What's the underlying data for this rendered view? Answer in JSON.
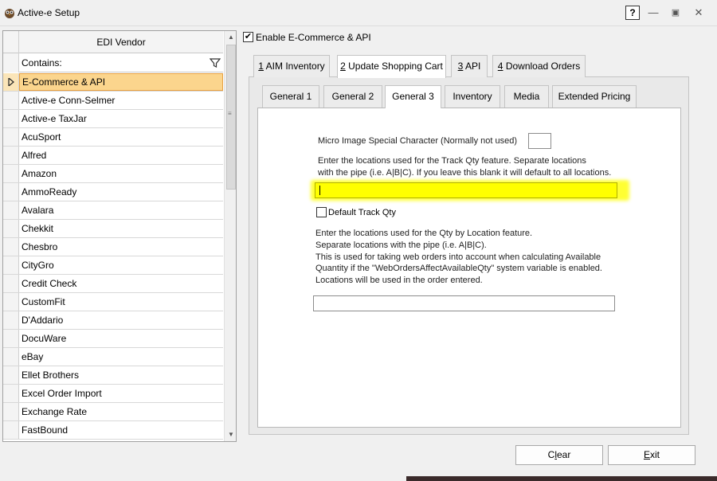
{
  "window": {
    "title": "Active-e Setup",
    "help_label": "?",
    "minimize_glyph": "—",
    "maximize_glyph": "▣",
    "close_glyph": "✕"
  },
  "vendor_grid": {
    "column_header": "EDI Vendor",
    "filter_label": "Contains:",
    "selected_index": 0,
    "rows": [
      "E-Commerce & API",
      "Active-e Conn-Selmer",
      "Active-e TaxJar",
      "AcuSport",
      "Alfred",
      "Amazon",
      "AmmoReady",
      "Avalara",
      "Chekkit",
      "Chesbro",
      "CityGro",
      "Credit Check",
      "CustomFit",
      "D'Addario",
      "DocuWare",
      "eBay",
      "Ellet Brothers",
      "Excel Order Import",
      "Exchange Rate",
      "FastBound"
    ]
  },
  "enable": {
    "label": "Enable E-Commerce & API",
    "checked": true
  },
  "outer_tabs": [
    {
      "hotkey": "1",
      "rest": " AIM Inventory"
    },
    {
      "hotkey": "2",
      "rest": " Update Shopping Cart"
    },
    {
      "hotkey": "3",
      "rest": " API"
    },
    {
      "hotkey": "4",
      "rest": " Download Orders"
    }
  ],
  "inner_tabs": [
    "General 1",
    "General 2",
    "General 3",
    "Inventory",
    "Media",
    "Extended Pricing"
  ],
  "general3": {
    "micro_image_label": "Micro Image Special Character (Normally not used)",
    "micro_image_value": "",
    "track_qty_desc": [
      "Enter the locations used for the Track Qty feature. Separate locations",
      "with the pipe (i.e. A|B|C). If you leave this blank it will default to all locations."
    ],
    "track_qty_value": "",
    "default_track_qty_label": "Default Track Qty",
    "default_track_qty_checked": false,
    "qty_by_location_desc": [
      "Enter the locations used for the Qty by Location feature.",
      "Separate locations with the pipe (i.e. A|B|C).",
      "This is used for taking web orders into account when calculating Available",
      "Quantity if the \"WebOrdersAffectAvailableQty\" system variable is enabled.",
      "Locations will be used in the order entered."
    ],
    "qty_by_location_value": ""
  },
  "buttons": {
    "clear_hotkey": "l",
    "clear_pre": "C",
    "clear_post": "ear",
    "exit_hotkey": "E",
    "exit_post": "xit"
  },
  "colors": {
    "selected_row": "#fbd58d",
    "highlight": "#ffff00"
  }
}
